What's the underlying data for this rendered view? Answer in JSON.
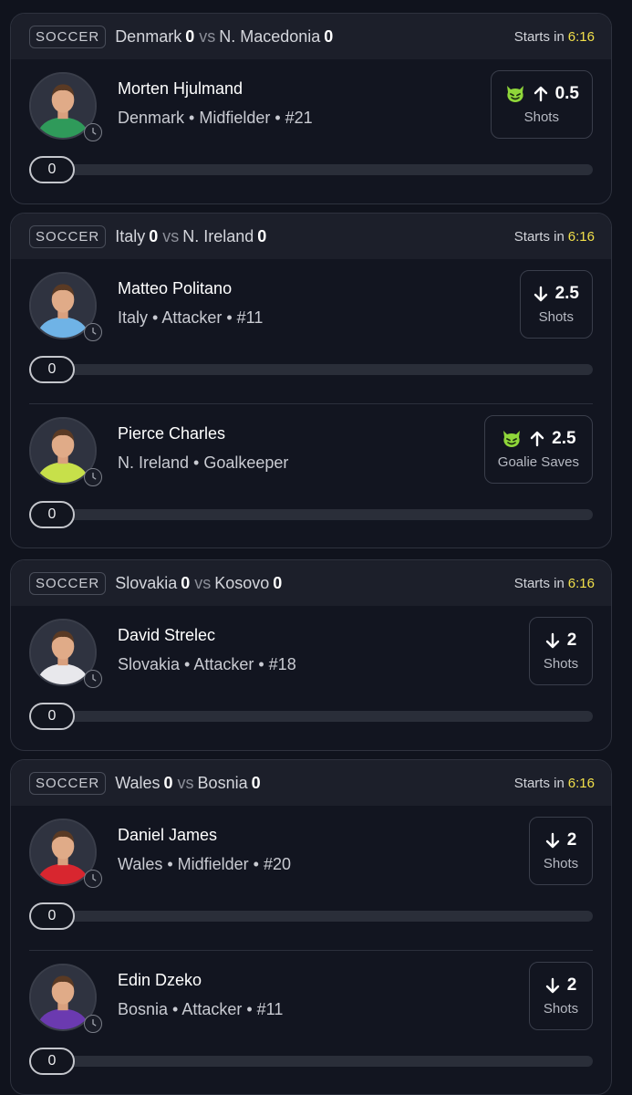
{
  "cards": [
    {
      "sport": "SOCCER",
      "home_team": "Denmark",
      "home_score": "0",
      "away_team": "N. Macedonia",
      "away_score": "0",
      "vs": "vs",
      "starts_label": "Starts in",
      "starts_time": "6:16",
      "players": [
        {
          "name": "Morten Hjulmand",
          "meta": "Denmark • Midfielder • #21",
          "line": "0.5",
          "category": "Shots",
          "direction": "up",
          "demon": true,
          "progress": "0",
          "jersey": "#2f9a5a"
        }
      ]
    },
    {
      "sport": "SOCCER",
      "home_team": "Italy",
      "home_score": "0",
      "away_team": "N. Ireland",
      "away_score": "0",
      "vs": "vs",
      "starts_label": "Starts in",
      "starts_time": "6:16",
      "players": [
        {
          "name": "Matteo Politano",
          "meta": "Italy • Attacker • #11",
          "line": "2.5",
          "category": "Shots",
          "direction": "down",
          "demon": false,
          "progress": "0",
          "jersey": "#6fb3e6"
        },
        {
          "name": "Pierce Charles",
          "meta": "N. Ireland • Goalkeeper",
          "line": "2.5",
          "category": "Goalie Saves",
          "direction": "up",
          "demon": true,
          "progress": "0",
          "jersey": "#c7e04a"
        }
      ]
    },
    {
      "sport": "SOCCER",
      "home_team": "Slovakia",
      "home_score": "0",
      "away_team": "Kosovo",
      "away_score": "0",
      "vs": "vs",
      "starts_label": "Starts in",
      "starts_time": "6:16",
      "players": [
        {
          "name": "David Strelec",
          "meta": "Slovakia • Attacker • #18",
          "line": "2",
          "category": "Shots",
          "direction": "down",
          "demon": false,
          "progress": "0",
          "jersey": "#e8e8ec"
        }
      ]
    },
    {
      "sport": "SOCCER",
      "home_team": "Wales",
      "home_score": "0",
      "away_team": "Bosnia",
      "away_score": "0",
      "vs": "vs",
      "starts_label": "Starts in",
      "starts_time": "6:16",
      "players": [
        {
          "name": "Daniel James",
          "meta": "Wales • Midfielder • #20",
          "line": "2",
          "category": "Shots",
          "direction": "down",
          "demon": false,
          "progress": "0",
          "jersey": "#d8262f"
        },
        {
          "name": "Edin Dzeko",
          "meta": "Bosnia • Attacker • #11",
          "line": "2",
          "category": "Shots",
          "direction": "down",
          "demon": false,
          "progress": "0",
          "jersey": "#6b3ab0"
        }
      ]
    }
  ],
  "colors": {
    "accent_time": "#f2e04a",
    "demon": "#8fd63a",
    "background": "#10131d"
  },
  "icons": {
    "demon": "demon-icon",
    "up": "arrow-up-icon",
    "down": "arrow-down-icon",
    "clock": "clock-icon"
  }
}
